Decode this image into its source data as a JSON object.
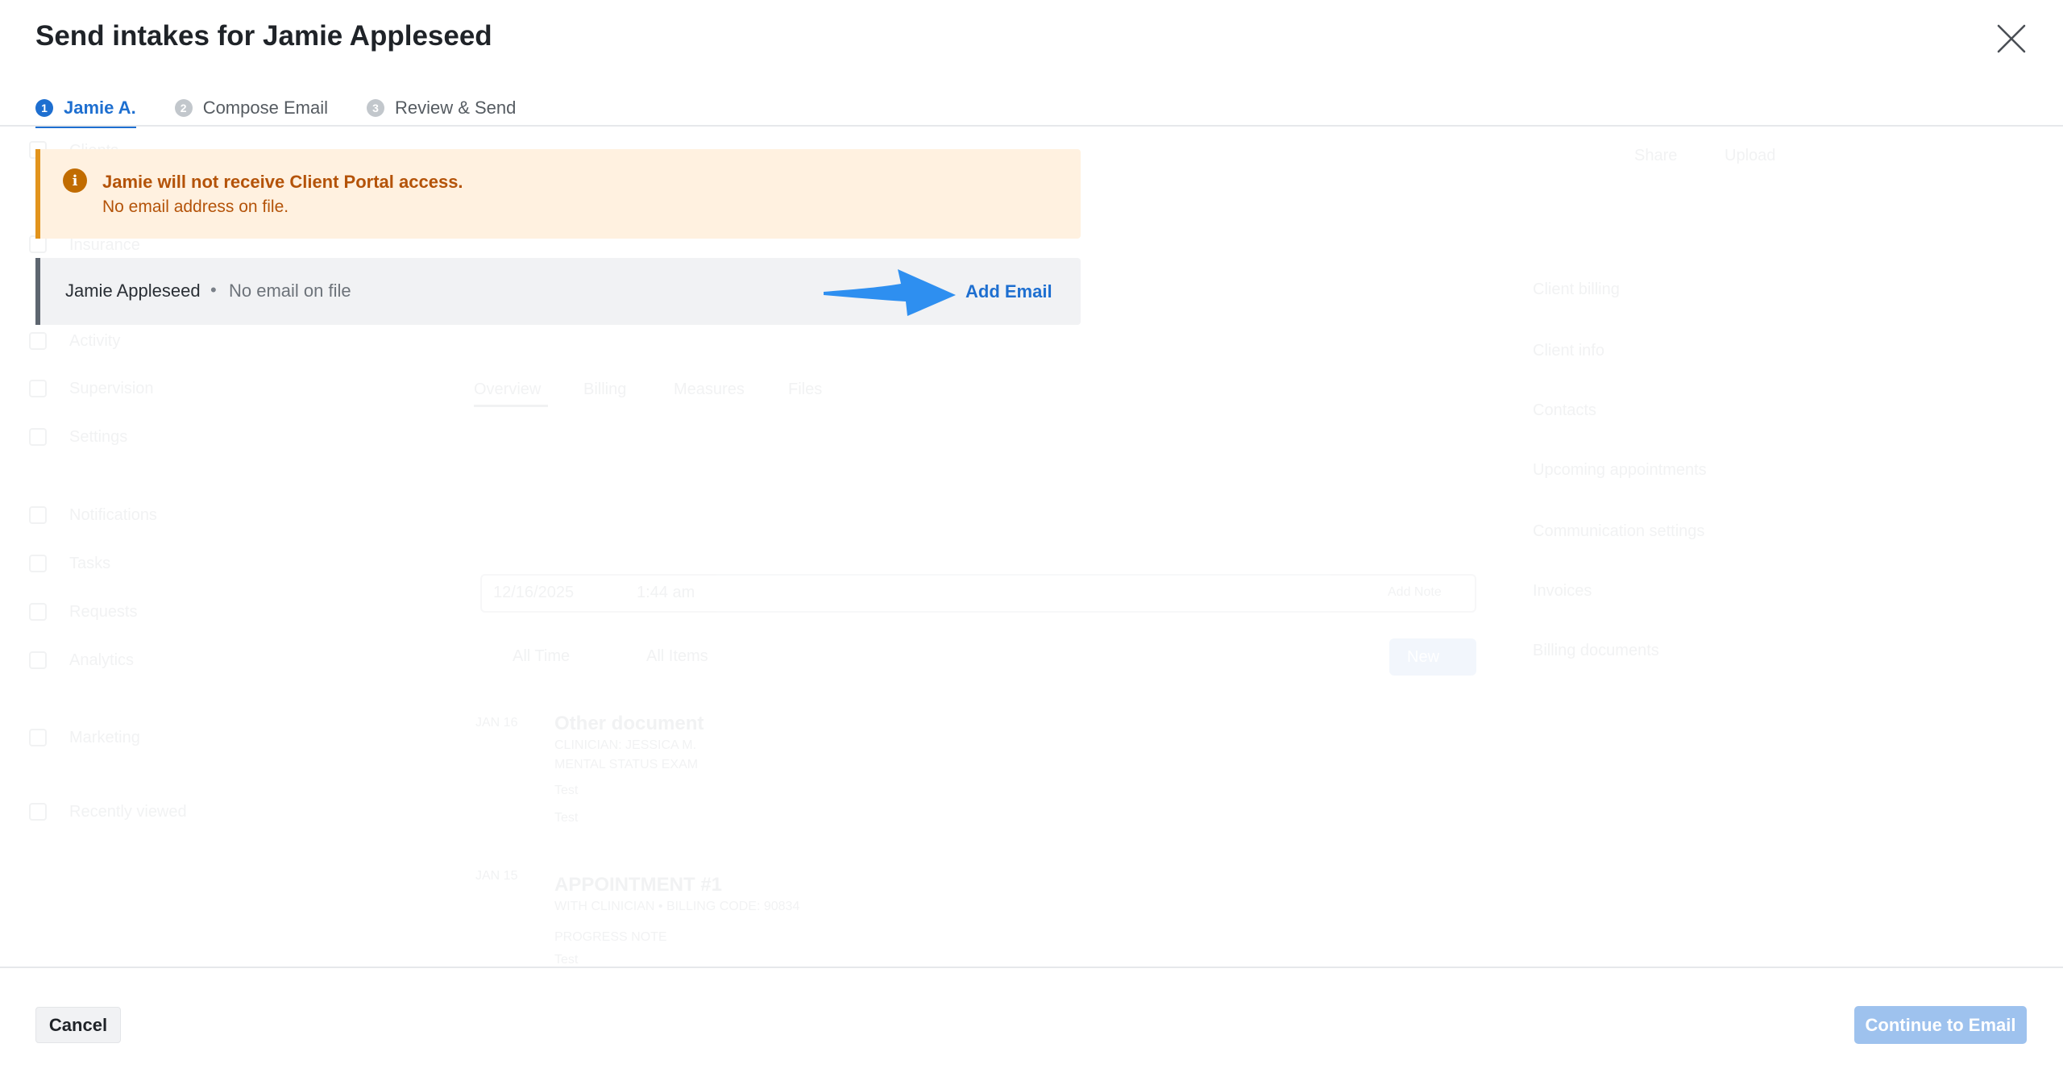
{
  "modal": {
    "title": "Send intakes for Jamie Appleseed",
    "close_icon": "close-icon"
  },
  "steps": [
    {
      "number": "1",
      "label": "Jamie A.",
      "active": true
    },
    {
      "number": "2",
      "label": "Compose Email",
      "active": false
    },
    {
      "number": "3",
      "label": "Review & Send",
      "active": false
    }
  ],
  "alert": {
    "icon": "info-icon",
    "title": "Jamie will not receive Client Portal access.",
    "message": "No email address on file.",
    "color": "#b45309",
    "background": "#fff1e0"
  },
  "recipient": {
    "name": "Jamie Appleseed",
    "separator": "•",
    "status": "No email on file",
    "action_label": "Add Email"
  },
  "annotation": {
    "icon": "arrow-right-icon",
    "color": "#2e8ff0"
  },
  "footer": {
    "cancel_label": "Cancel",
    "continue_label": "Continue to Email",
    "continue_disabled": true
  },
  "background_page": {
    "sidebar_items": [
      "Clients",
      "Insurance",
      "Activity",
      "Supervision",
      "Settings",
      "Notifications",
      "Tasks",
      "Requests",
      "Analytics",
      "Marketing",
      "Recently viewed"
    ],
    "header_actions": [
      "Share",
      "Upload"
    ],
    "tabs": [
      "Overview",
      "Billing",
      "Measures",
      "Files"
    ],
    "date": "12/16/2025",
    "time": "1:44 am",
    "filters": [
      "All Time",
      "All Items"
    ],
    "new_button": "New",
    "add_note": "Add Note",
    "entries": [
      {
        "date": "JAN 16",
        "title": "Other document",
        "subtitle": "CLINICIAN: JESSICA M.",
        "tag": "MENTAL STATUS EXAM",
        "lines": [
          "Test",
          "Test"
        ]
      },
      {
        "date": "JAN 15",
        "title": "APPOINTMENT #1",
        "subtitle": "WITH CLINICIAN • BILLING CODE: 90834",
        "tag": "PROGRESS NOTE",
        "lines": [
          "Test"
        ]
      }
    ],
    "right_panel": [
      "Client billing",
      "Client info",
      "Contacts",
      "Upcoming appointments",
      "Communication settings",
      "Invoices",
      "Billing documents"
    ]
  },
  "colors": {
    "accent": "#1e6fd0",
    "warning_border": "#e2941d",
    "disabled_button": "#9ec2ee"
  }
}
